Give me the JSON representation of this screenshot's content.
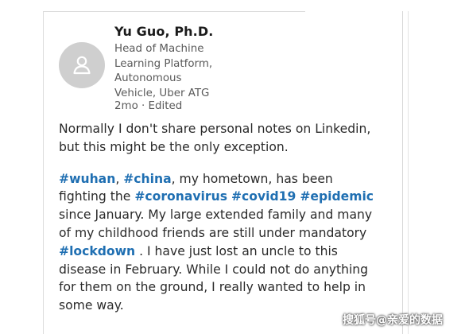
{
  "author": {
    "name": "Yu Guo, Ph.D.",
    "headline_lines": [
      "Head of Machine",
      "Learning Platform,",
      "Autonomous",
      "Vehicle, Uber ATG"
    ],
    "meta": "2mo · Edited"
  },
  "post": {
    "paragraph1": {
      "line1": "Normally I don't share personal notes on Linkedin,",
      "line2": "but this might be the only exception."
    },
    "paragraph2": {
      "tag_wuhan": "#wuhan",
      "comma1": ", ",
      "tag_china": "#china",
      "line1_rest": ", my hometown, has been",
      "line2_start": "fighting the ",
      "tag_coronavirus": "#coronavirus",
      "space1": " ",
      "tag_covid19": "#covid19",
      "space2": " ",
      "tag_epidemic": "#epidemic",
      "line3": "since January. My large extended family and many",
      "line4": "of my childhood friends are still under mandatory",
      "tag_lockdown": "#lockdown",
      "line5_rest": " . I have just lost an uncle to this",
      "line6": "disease in February. While I could not do anything",
      "line7": "for them on the ground, I really wanted to help in",
      "line8": "some way."
    }
  },
  "watermark": "搜狐号@亲爱的数据",
  "colors": {
    "hashtag": "#1f6fb2",
    "text": "#2a2a2a",
    "secondary_text": "#5a5a5a",
    "avatar_bg": "#cfcfcf"
  },
  "icons": {
    "avatar": "person-silhouette-icon"
  }
}
